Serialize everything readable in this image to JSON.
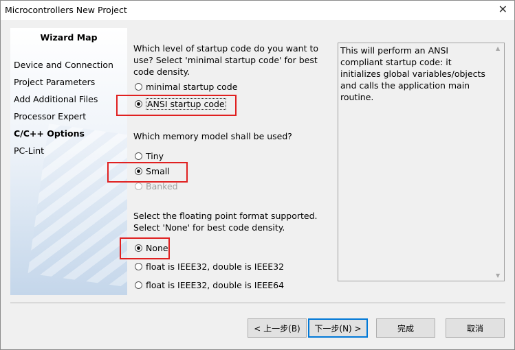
{
  "window": {
    "title": "Microcontrollers New Project",
    "close_glyph": "✕"
  },
  "sidebar": {
    "title": "Wizard Map",
    "items": [
      {
        "label": "Device and Connection",
        "active": false
      },
      {
        "label": "Project Parameters",
        "active": false
      },
      {
        "label": "Add Additional Files",
        "active": false
      },
      {
        "label": "Processor Expert",
        "active": false
      },
      {
        "label": "C/C++ Options",
        "active": true
      },
      {
        "label": "PC-Lint",
        "active": false
      }
    ]
  },
  "startup": {
    "question": "Which level of startup code do you want to use? Select 'minimal startup code' for best code density.",
    "options": [
      {
        "label": "minimal startup code",
        "checked": false
      },
      {
        "label": "ANSI startup code",
        "checked": true
      }
    ]
  },
  "memory": {
    "question": "Which memory model shall be used?",
    "options": [
      {
        "label": "Tiny",
        "checked": false
      },
      {
        "label": "Small",
        "checked": true
      },
      {
        "label": "Banked",
        "checked": false,
        "disabled": true
      }
    ]
  },
  "float": {
    "question": "Select the floating point format supported. Select 'None' for best code density.",
    "options": [
      {
        "label": "None",
        "checked": true
      },
      {
        "label": "float is IEEE32, double is IEEE32",
        "checked": false
      },
      {
        "label": "float is IEEE32, double is IEEE64",
        "checked": false
      }
    ]
  },
  "description": "This will perform an ANSI compliant startup code: it initializes global variables/objects and calls the application main routine.",
  "buttons": {
    "back": "< 上一步(B)",
    "next": "下一步(N) >",
    "finish": "完成",
    "cancel": "取消"
  },
  "highlight_color": "#e02020"
}
